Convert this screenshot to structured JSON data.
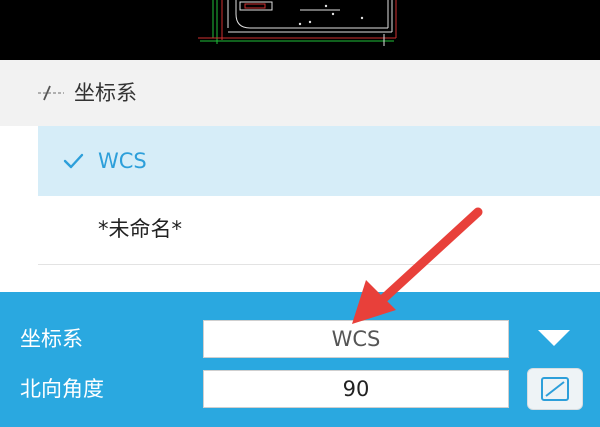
{
  "colors": {
    "accent": "#2aa8e0",
    "selected_bg": "#d6edf8",
    "selected_text": "#2d9fda",
    "arrow": "#e8403a"
  },
  "panel": {
    "title": "坐标系",
    "title_icon": "axis-line-icon"
  },
  "coordinate_list": {
    "items": [
      {
        "label": "WCS",
        "selected": true,
        "icon": "check-icon"
      },
      {
        "label": "*未命名*",
        "selected": false
      }
    ]
  },
  "settings": {
    "coordinate_system_label": "坐标系",
    "coordinate_system_value": "WCS",
    "dropdown_icon": "triangle-down-icon",
    "north_angle_label": "北向角度",
    "north_angle_value": "90",
    "pick_icon": "pick-angle-icon"
  }
}
